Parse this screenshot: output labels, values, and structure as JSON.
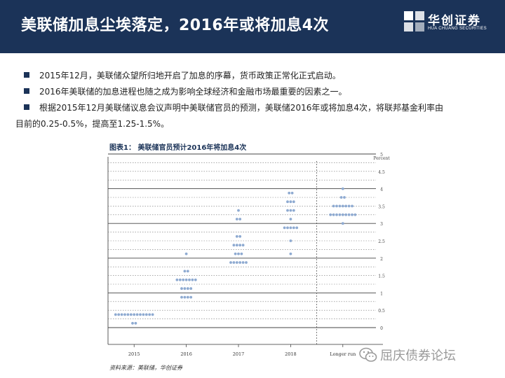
{
  "slide": {
    "title": "美联储加息尘埃落定，2016年或将加息4次"
  },
  "logo": {
    "name_cn": "华创证券",
    "name_en": "HUA CHUANG SECURITIES"
  },
  "bullets": [
    {
      "text": "2015年12月，美联储众望所归地开启了加息的序幕，货币政策正常化正式启动。"
    },
    {
      "text": "2016年美联储的加息进程也随之成为影响全球经济和金融市场最重要的因素之一。"
    },
    {
      "line1": "根据2015年12月美联储议息会议声明中美联储官员的预测，美联储2016年或将加息4次，将联邦基金利率由",
      "line2": "目前的0.25-0.5%，提高至1.25-1.5%。"
    }
  ],
  "figure": {
    "caption": "图表1： 美联储官员预计2016年将加息4次",
    "source": "资料来源：美联储，华创证券"
  },
  "chart_data": {
    "type": "scatter",
    "title": "",
    "ylabel": "Percent",
    "ylim": [
      0,
      5
    ],
    "yticks": [
      "0",
      "0.5",
      "1",
      "1.5",
      "2",
      "2.5",
      "3",
      "3.5",
      "4",
      "4.5",
      "5"
    ],
    "categories": [
      "2015",
      "2016",
      "2017",
      "2018",
      "Longer run"
    ],
    "dot_color": "#8eaad1",
    "series": [
      {
        "category": "2015",
        "points": [
          {
            "y": 0.375,
            "count": 13
          },
          {
            "y": 0.125,
            "count": 2
          }
        ]
      },
      {
        "category": "2016",
        "points": [
          {
            "y": 0.875,
            "count": 4
          },
          {
            "y": 1.125,
            "count": 4
          },
          {
            "y": 1.375,
            "count": 7
          },
          {
            "y": 1.625,
            "count": 2
          },
          {
            "y": 2.125,
            "count": 1
          }
        ]
      },
      {
        "category": "2017",
        "points": [
          {
            "y": 1.875,
            "count": 6
          },
          {
            "y": 2.125,
            "count": 3
          },
          {
            "y": 2.375,
            "count": 4
          },
          {
            "y": 2.625,
            "count": 2
          },
          {
            "y": 3.125,
            "count": 2
          },
          {
            "y": 3.375,
            "count": 1
          }
        ]
      },
      {
        "category": "2018",
        "points": [
          {
            "y": 2.125,
            "count": 1
          },
          {
            "y": 2.5,
            "count": 1
          },
          {
            "y": 2.875,
            "count": 5
          },
          {
            "y": 3.125,
            "count": 1
          },
          {
            "y": 3.375,
            "count": 3
          },
          {
            "y": 3.625,
            "count": 3
          },
          {
            "y": 3.875,
            "count": 2
          }
        ]
      },
      {
        "category": "Longer run",
        "points": [
          {
            "y": 3.0,
            "count": 1
          },
          {
            "y": 3.25,
            "count": 9
          },
          {
            "y": 3.5,
            "count": 7
          },
          {
            "y": 3.75,
            "count": 2
          },
          {
            "y": 4.0,
            "count": 1
          }
        ]
      }
    ]
  },
  "watermark": {
    "text": "屈庆债券论坛"
  },
  "colors": {
    "header_bg": "#1b3358",
    "accent": "#1b3358"
  }
}
